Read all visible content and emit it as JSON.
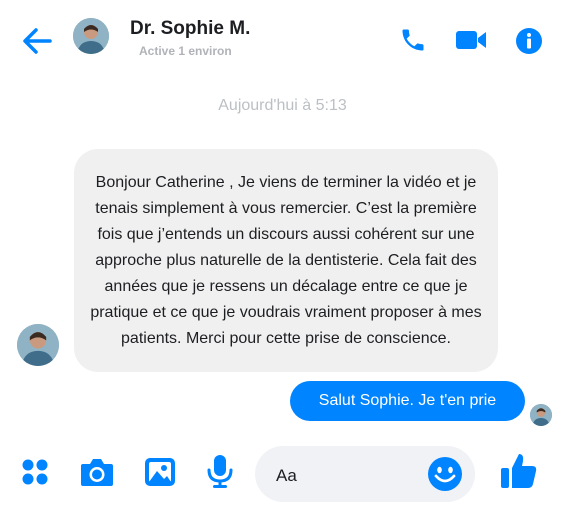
{
  "header": {
    "contact_name": "Dr. Sophie M.",
    "status": "Active 1 environ",
    "icons": [
      "back-arrow-icon",
      "phone-icon",
      "video-camera-icon",
      "info-icon"
    ],
    "accent_color": "#0084ff"
  },
  "conversation": {
    "timestamp": "Aujourd'hui à 5:13",
    "messages": [
      {
        "direction": "incoming",
        "text": "Bonjour Catherine , Je viens de terminer la vidéo et je tenais simplement à vous remercier. C’est la première fois que j’entends un discours aussi cohérent sur une approche plus naturelle de la dentisterie. Cela fait des années que je ressens un décalage entre ce que je pratique et ce que je voudrais vraiment proposer à mes patients. Merci pour cette prise de conscience."
      },
      {
        "direction": "outgoing",
        "text": "Salut Sophie. Je t'en prie"
      }
    ]
  },
  "composer": {
    "placeholder": "Aa",
    "icons": [
      "apps-icon",
      "camera-icon",
      "gallery-icon",
      "microphone-icon",
      "emoji-icon",
      "thumbs-up-icon"
    ]
  }
}
